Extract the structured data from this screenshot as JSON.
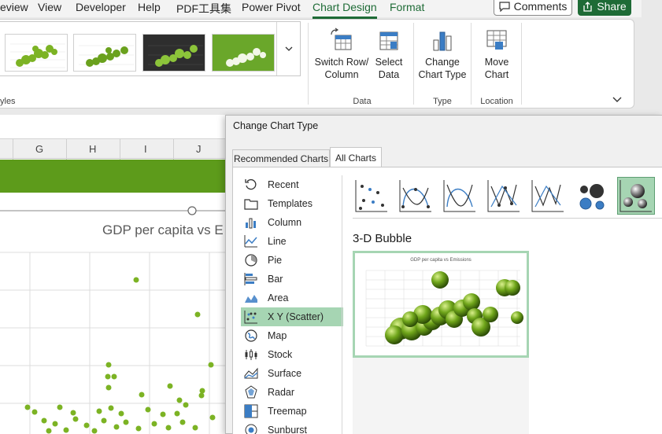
{
  "menu": {
    "tabs": [
      "eview",
      "View",
      "Developer",
      "Help",
      "PDF工具集",
      "Power Pivot",
      "Chart Design",
      "Format"
    ],
    "active": "Chart Design",
    "comments_label": "Comments",
    "share_label": "Share"
  },
  "ribbon": {
    "styles_group_label": "yles",
    "data_group_label": "Data",
    "type_group_label": "Type",
    "location_group_label": "Location",
    "switch_row_column_line1": "Switch Row/",
    "switch_row_column_line2": "Column",
    "select_data_line1": "Select",
    "select_data_line2": "Data",
    "change_chart_type_line1": "Change",
    "change_chart_type_line2": "Chart Type",
    "move_chart_line1": "Move",
    "move_chart_line2": "Chart"
  },
  "sheet": {
    "columns": [
      "G",
      "H",
      "I",
      "J"
    ],
    "chart_title": "GDP per capita vs E"
  },
  "dialog": {
    "title": "Change Chart Type",
    "tab_recommended": "Recommended Charts",
    "tab_all": "All Charts",
    "chart_types": [
      {
        "label": "Recent",
        "icon": "recent-icon"
      },
      {
        "label": "Templates",
        "icon": "templates-icon"
      },
      {
        "label": "Column",
        "icon": "column-chart-icon"
      },
      {
        "label": "Line",
        "icon": "line-chart-icon"
      },
      {
        "label": "Pie",
        "icon": "pie-chart-icon"
      },
      {
        "label": "Bar",
        "icon": "bar-chart-icon"
      },
      {
        "label": "Area",
        "icon": "area-chart-icon"
      },
      {
        "label": "X Y (Scatter)",
        "icon": "scatter-chart-icon"
      },
      {
        "label": "Map",
        "icon": "map-chart-icon"
      },
      {
        "label": "Stock",
        "icon": "stock-chart-icon"
      },
      {
        "label": "Surface",
        "icon": "surface-chart-icon"
      },
      {
        "label": "Radar",
        "icon": "radar-chart-icon"
      },
      {
        "label": "Treemap",
        "icon": "treemap-chart-icon"
      },
      {
        "label": "Sunburst",
        "icon": "sunburst-chart-icon"
      }
    ],
    "selected_type": "X Y (Scatter)",
    "subtype_name": "3-D Bubble",
    "preview_title": "GDP per capita vs Emissions"
  },
  "colors": {
    "accent_green": "#1e6b36",
    "selection_green": "#a6d5b3",
    "sheet_band_green": "#5d9b1b",
    "scatter_point_green": "#7cb324"
  }
}
